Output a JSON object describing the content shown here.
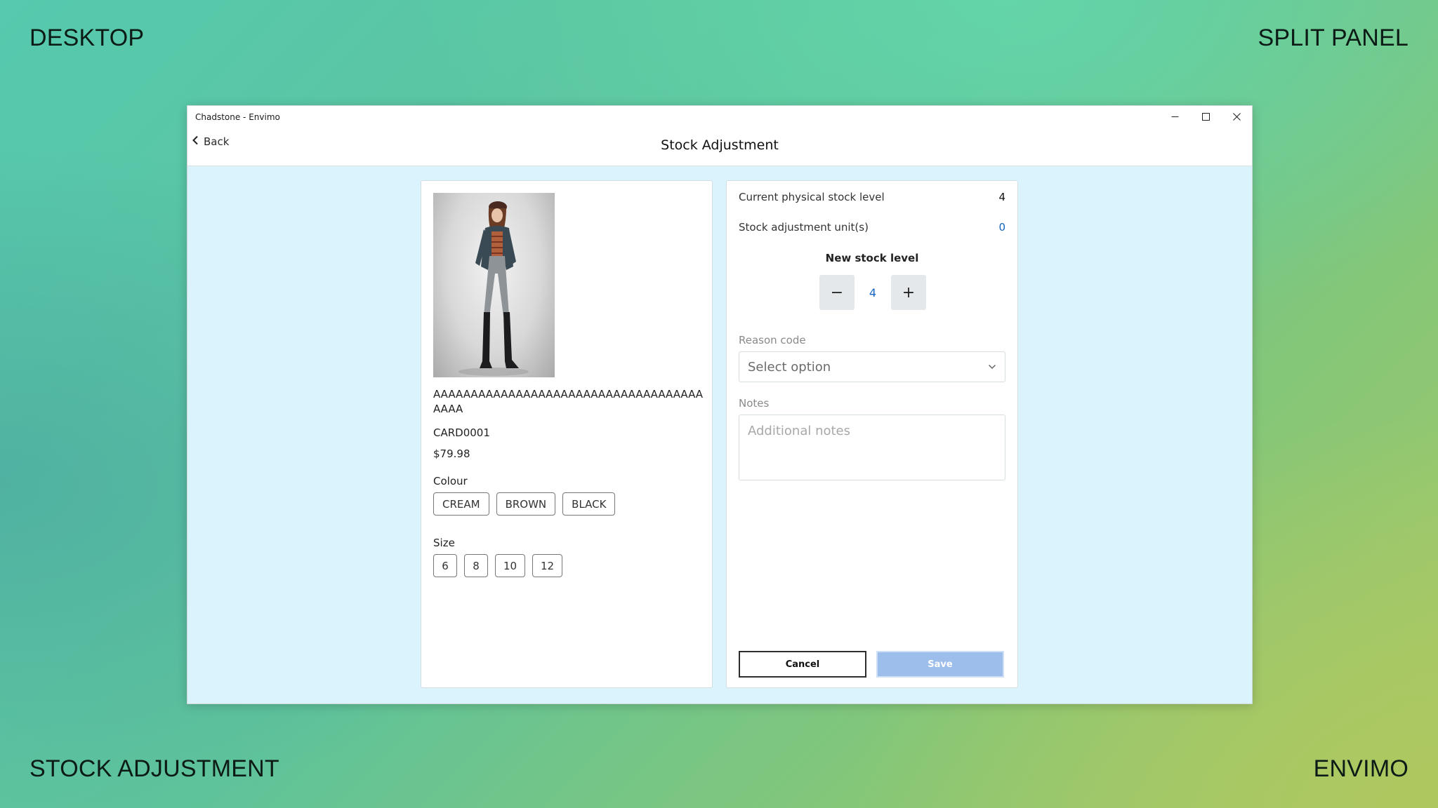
{
  "corners": {
    "top_left": "DESKTOP",
    "top_right": "SPLIT PANEL",
    "bottom_left": "STOCK ADJUSTMENT",
    "bottom_right": "ENVIMO"
  },
  "window": {
    "title": "Chadstone - Envimo",
    "controls": [
      "minimize-icon",
      "maximize-icon",
      "close-icon"
    ]
  },
  "appbar": {
    "back_label": "Back",
    "title": "Stock Adjustment"
  },
  "product": {
    "name": "AAAAAAAAAAAAAAAAAAAAAAAAAAAAAAAAAAAAAAAA",
    "sku": "CARD0001",
    "price": "$79.98",
    "colour_label": "Colour",
    "colours": [
      "CREAM",
      "BROWN",
      "BLACK"
    ],
    "size_label": "Size",
    "sizes": [
      "6",
      "8",
      "10",
      "12"
    ]
  },
  "stock": {
    "current_label": "Current physical stock level",
    "current_value": "4",
    "adjustment_label": "Stock adjustment unit(s)",
    "adjustment_value": "0",
    "new_level_label": "New stock level",
    "new_level_value": "4",
    "minus": "−",
    "plus": "+"
  },
  "form": {
    "reason_label": "Reason code",
    "reason_placeholder": "Select option",
    "notes_label": "Notes",
    "notes_placeholder": "Additional notes",
    "cancel_label": "Cancel",
    "save_label": "Save"
  },
  "colors": {
    "accent_blue": "#1565c0",
    "save_button": "#9dbdeb",
    "content_bg": "#dbf3fc"
  }
}
